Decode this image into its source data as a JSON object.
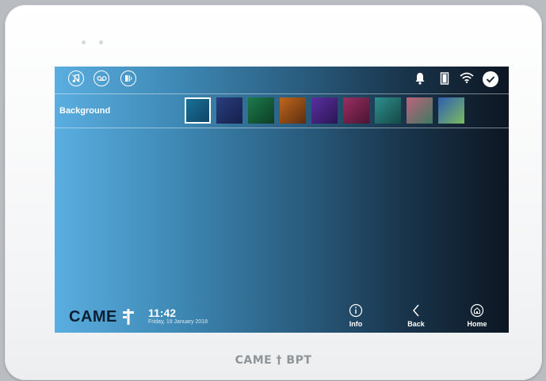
{
  "device": {
    "brand_bottom": "CAME † BPT"
  },
  "topbar": {
    "left_icons": [
      "music-note-icon",
      "voicemail-icon",
      "door-phone-icon"
    ],
    "right_icons": [
      "bell-icon",
      "door-icon",
      "wifi-icon",
      "check-icon"
    ]
  },
  "settings": {
    "background_label": "Background",
    "swatches": [
      {
        "name": "light-blue",
        "colors": [
          "#1a6f98",
          "#0f4667"
        ],
        "selected": true
      },
      {
        "name": "navy",
        "colors": [
          "#2a3d7e",
          "#15204a"
        ],
        "selected": false
      },
      {
        "name": "green",
        "colors": [
          "#1c7a4a",
          "#0d3d25"
        ],
        "selected": false
      },
      {
        "name": "orange",
        "colors": [
          "#c0661c",
          "#5b2e10"
        ],
        "selected": false
      },
      {
        "name": "violet",
        "colors": [
          "#5a2fa0",
          "#2b1654"
        ],
        "selected": false
      },
      {
        "name": "magenta",
        "colors": [
          "#9a2f62",
          "#4a1431"
        ],
        "selected": false
      },
      {
        "name": "teal",
        "colors": [
          "#2f8f8e",
          "#144846"
        ],
        "selected": false
      },
      {
        "name": "sunset",
        "colors": [
          "#c0627a",
          "#3d7a62"
        ],
        "selected": false
      },
      {
        "name": "aurora",
        "colors": [
          "#2e5fb3",
          "#7cba5f"
        ],
        "selected": false
      }
    ]
  },
  "footer": {
    "logo": "CAME",
    "time": "11:42",
    "date": "Friday, 19 January 2018",
    "info_label": "Info",
    "back_label": "Back",
    "home_label": "Home"
  }
}
